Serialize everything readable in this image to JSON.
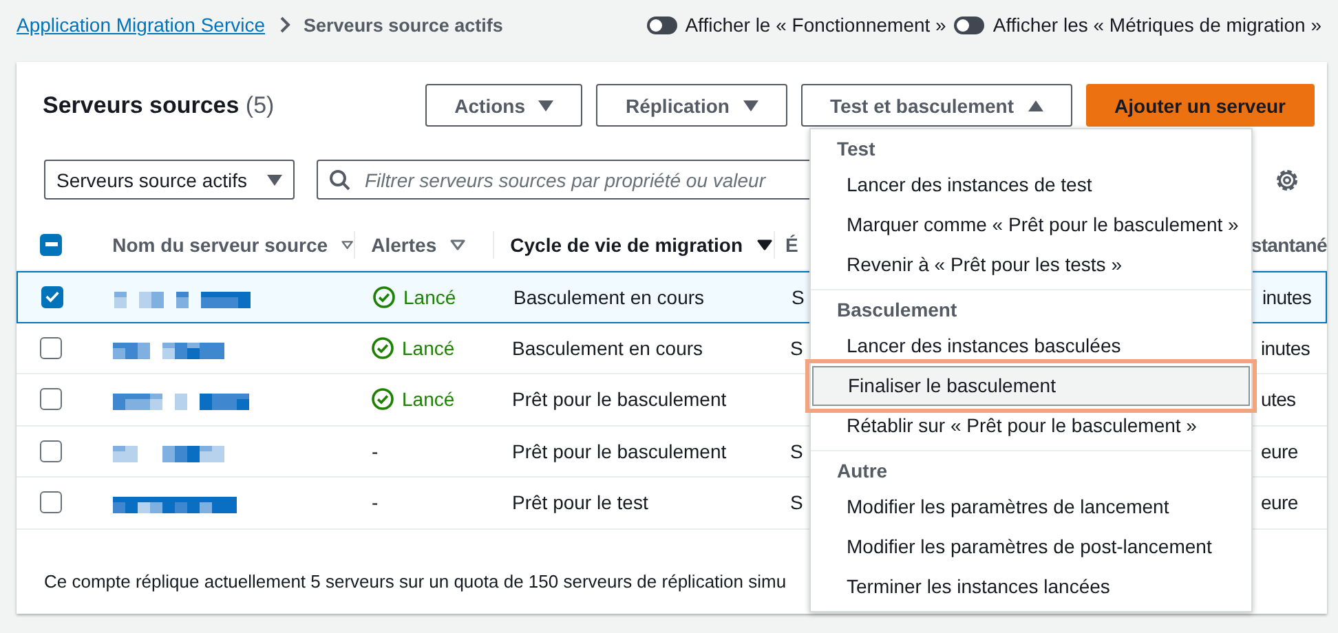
{
  "breadcrumb": {
    "link": "Application Migration Service",
    "current": "Serveurs source actifs"
  },
  "toggles": [
    {
      "label": "Afficher le « Fonctionnement »",
      "on": false
    },
    {
      "label": "Afficher les « Métriques de migration »",
      "on": false
    }
  ],
  "panel": {
    "title": "Serveurs sources",
    "count": "(5)",
    "buttons": [
      {
        "label": "Actions",
        "kind": "dropdown",
        "expanded": false
      },
      {
        "label": "Réplication",
        "kind": "dropdown",
        "expanded": false
      },
      {
        "label": "Test et basculement",
        "kind": "dropdown",
        "expanded": true
      },
      {
        "label": "Ajouter un serveur",
        "kind": "primary"
      }
    ]
  },
  "filter_select": "Serveurs source actifs",
  "search": {
    "placeholder": "Filtrer serveurs sources par propriété ou valeur"
  },
  "table": {
    "header_checkbox": {
      "checked": true,
      "indeterminate": true
    },
    "columns": [
      {
        "label": "Nom du serveur source",
        "sorted": false
      },
      {
        "label": "Alertes",
        "sorted": false
      },
      {
        "label": "Cycle de vie de migration",
        "sorted": true
      },
      {
        "label": "É"
      },
      {
        "label": "stantané"
      }
    ],
    "rows": [
      {
        "selected": true,
        "alert": {
          "kind": "ok",
          "text": "Lancé"
        },
        "lifecycle": "Basculement en cours",
        "column_4": "S",
        "column_5": "inutes"
      },
      {
        "selected": false,
        "alert": {
          "kind": "ok",
          "text": "Lancé"
        },
        "lifecycle": "Basculement en cours",
        "column_4": "S",
        "column_5": "inutes"
      },
      {
        "selected": false,
        "alert": {
          "kind": "ok",
          "text": "Lancé"
        },
        "lifecycle": "Prêt pour le basculement",
        "column_5": "utes"
      },
      {
        "selected": false,
        "alert": {
          "kind": "none",
          "text": "-"
        },
        "lifecycle": "Prêt pour le basculement",
        "column_4": "S",
        "column_5": "eure"
      },
      {
        "selected": false,
        "alert": {
          "kind": "none",
          "text": "-"
        },
        "lifecycle": "Prêt pour le test",
        "column_4": "S",
        "column_5": "eure"
      }
    ]
  },
  "footer": "Ce compte réplique actuellement 5 serveurs sur un quota de 150 serveurs de réplication simu",
  "menu": [
    {
      "title": "Test",
      "items": [
        {
          "label": "Lancer des instances de test",
          "highlighted": false
        },
        {
          "label": "Marquer comme « Prêt pour le basculement »",
          "highlighted": false
        },
        {
          "label": "Revenir à « Prêt pour les tests »",
          "highlighted": false
        }
      ]
    },
    {
      "title": "Basculement",
      "items": [
        {
          "label": "Lancer des instances basculées",
          "highlighted": false
        },
        {
          "label": "Finaliser le basculement",
          "highlighted": true
        },
        {
          "label": "Rétablir sur « Prêt pour le basculement »",
          "highlighted": false
        }
      ]
    },
    {
      "title": "Autre",
      "items": [
        {
          "label": "Modifier les paramètres de lancement",
          "highlighted": false
        },
        {
          "label": "Modifier les paramètres de post-lancement",
          "highlighted": false
        },
        {
          "label": "Terminer les instances lancées",
          "highlighted": false
        }
      ]
    }
  ]
}
